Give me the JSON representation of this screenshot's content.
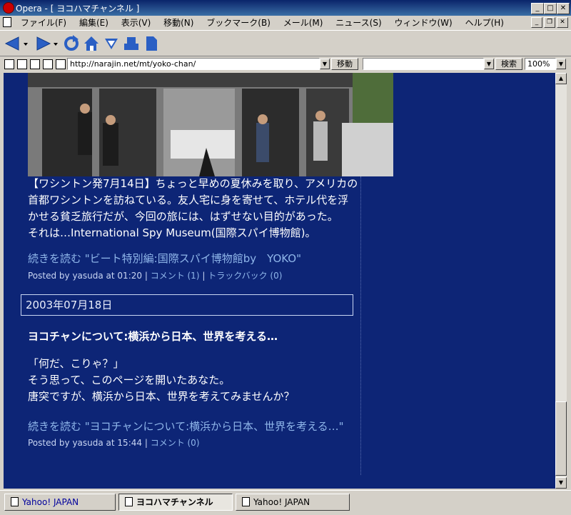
{
  "window": {
    "title": "Opera - [ ヨコハマチャンネル ]"
  },
  "menu": {
    "items": [
      "ファイル(F)",
      "編集(E)",
      "表示(V)",
      "移動(N)",
      "ブックマーク(B)",
      "メール(M)",
      "ニュース(S)",
      "ウィンドウ(W)",
      "ヘルプ(H)"
    ]
  },
  "address": {
    "url": "http://narajin.net/mt/yoko-chan/",
    "go_label": "移動",
    "search_label": "検索",
    "zoom": "100%"
  },
  "post1": {
    "body": [
      "【ワシントン発7月14日】ちょっと早めの夏休みを取り、アメリカの",
      "首都ワシントンを訪ねている。友人宅に身を寄せて、ホテル代を浮",
      "かせる貧乏旅行だが、今回の旅には、はずせない目的があった。",
      "それは…International Spy Museum(国際スパイ博物館)。"
    ],
    "more_link": "続きを読む \"ビート特別編:国際スパイ博物館by　YOKO\"",
    "posted_by": "Posted by yasuda at 01:20 | ",
    "comments": "コメント (1)",
    "sep": " | ",
    "trackback": "トラックバック (0)"
  },
  "date_header": "2003年07月18日",
  "post2": {
    "title": "ヨコチャンについて:横浜から日本、世界を考える…",
    "body": [
      "「何だ、こりゃ？」",
      "そう思って、このページを開いたあなた。",
      "唐突ですが、横浜から日本、世界を考えてみませんか？"
    ],
    "more_link": "続きを読む \"ヨコチャンについて:横浜から日本、世界を考える…\"",
    "posted_by": "Posted by yasuda at 15:44 | ",
    "comments": "コメント (0)"
  },
  "tabs": [
    {
      "label": "Yahoo! JAPAN"
    },
    {
      "label": "ヨコハマチャンネル"
    },
    {
      "label": "Yahoo! JAPAN"
    }
  ]
}
